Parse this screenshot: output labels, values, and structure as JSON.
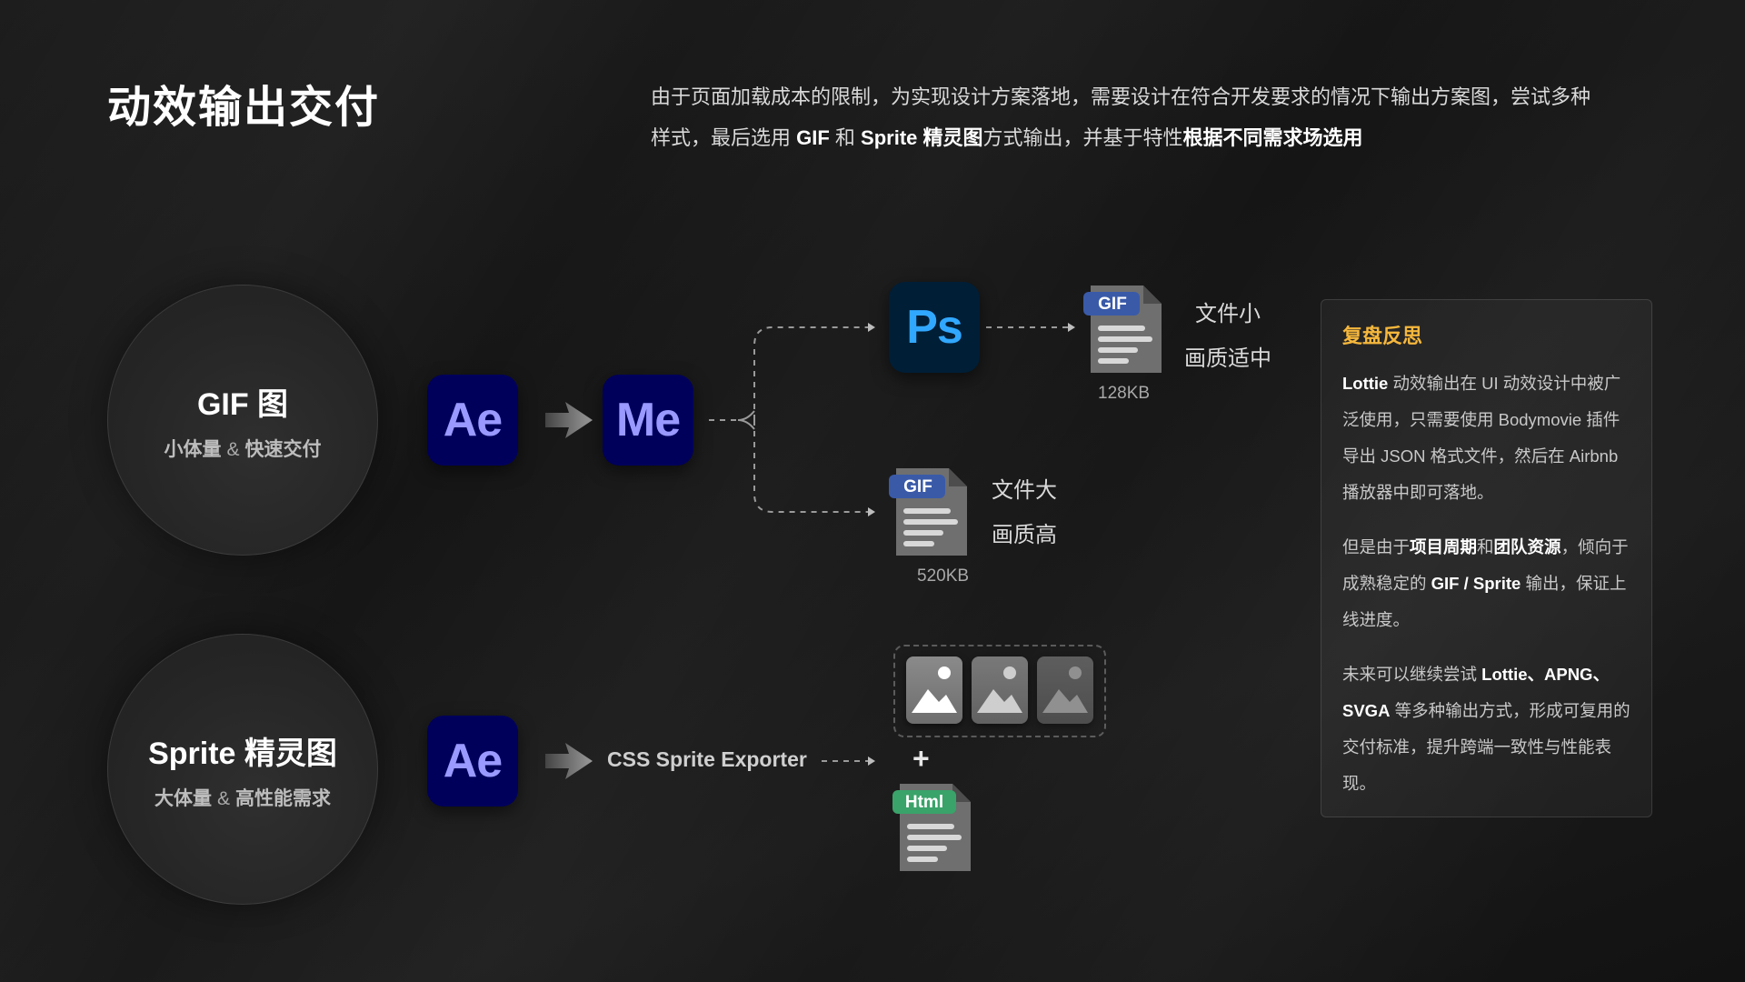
{
  "title": "动效输出交付",
  "intro": {
    "p1": "由于页面加载成本的限制，为实现设计方案落地，需要设计在符合开发要求的情况下输出方案图，尝试多种样式，最后选用 ",
    "b1": "GIF",
    "p2": " 和 ",
    "b2": "Sprite 精灵图",
    "p3": "方式输出，并基于特性",
    "b3": "根据不同需求场选用"
  },
  "gif_row": {
    "circle_title": "GIF 图",
    "circle_sub_a": "小体量",
    "circle_amp": "&",
    "circle_sub_b": "快速交付",
    "app1": "Ae",
    "app2": "Me",
    "app3": "Ps",
    "file_top": {
      "badge": "GIF",
      "size": "128KB",
      "line1": "文件小",
      "line2": "画质适中"
    },
    "file_bottom": {
      "badge": "GIF",
      "size": "520KB",
      "line1": "文件大",
      "line2": "画质高"
    }
  },
  "sprite_row": {
    "circle_title": "Sprite 精灵图",
    "circle_sub_a": "大体量",
    "circle_amp": "&",
    "circle_sub_b": "高性能需求",
    "app1": "Ae",
    "exporter": "CSS Sprite Exporter",
    "plus": "+",
    "file": {
      "badge": "Html"
    }
  },
  "review": {
    "title": "复盘反思",
    "p1_b1": "Lottie",
    "p1_t1": " 动效输出在 UI 动效设计中被广泛使用，只需要使用 Bodymovie 插件导出 JSON 格式文件，然后在 Airbnb 播放器中即可落地。",
    "p2_t1": "但是由于",
    "p2_b1": "项目周期",
    "p2_t2": "和",
    "p2_b2": "团队资源",
    "p2_t3": "，倾向于成熟稳定的 ",
    "p2_b3": "GIF / Sprite",
    "p2_t4": " 输出，保证上线进度。",
    "p3_t1": "未来可以继续尝试 ",
    "p3_b1": "Lottie、APNG、SVGA",
    "p3_t2": " 等多种输出方式，形成可复用的交付标准，提升跨端一致性与性能表现。"
  },
  "colors": {
    "review_title": "#f5b73c",
    "gif_badge": "#3a5aa8",
    "html_badge": "#3aa36a",
    "adobe_bg": "#00005b",
    "ps_bg": "#001e36"
  }
}
